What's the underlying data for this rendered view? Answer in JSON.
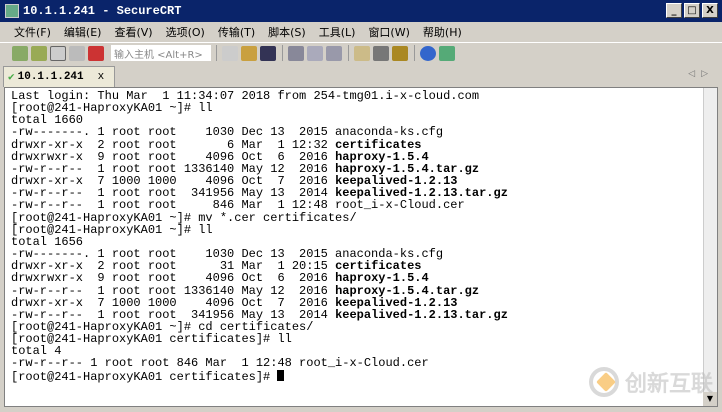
{
  "window": {
    "title": "10.1.1.241 - SecureCRT",
    "min": "_",
    "max": "□",
    "close": "X"
  },
  "menu": [
    "文件(F)",
    "编辑(E)",
    "查看(V)",
    "选项(O)",
    "传输(T)",
    "脚本(S)",
    "工具(L)",
    "窗口(W)",
    "帮助(H)"
  ],
  "toolbar": {
    "host_placeholder": "输入主机 <Alt+R>"
  },
  "tab": {
    "label": "10.1.1.241",
    "close": "x",
    "check": "✔",
    "arrows": "◁▷"
  },
  "terminal": {
    "lines": [
      [
        {
          "t": "Last login: Thu Mar  1 11:34:07 2018 from 254-tmg01.i-x-cloud.com"
        }
      ],
      [
        {
          "t": "[root@241-HaproxyKA01 ~]# ll"
        }
      ],
      [
        {
          "t": "total 1660"
        }
      ],
      [
        {
          "t": "-rw-------. 1 root root    1030 Dec 13  2015 anaconda-ks.cfg"
        }
      ],
      [
        {
          "t": "drwxr-xr-x  2 root root       6 Mar  1 12:32 "
        },
        {
          "t": "certificates",
          "b": true
        }
      ],
      [
        {
          "t": "drwxrwxr-x  9 root root    4096 Oct  6  2016 "
        },
        {
          "t": "haproxy-1.5.4",
          "b": true
        }
      ],
      [
        {
          "t": "-rw-r--r--  1 root root 1336140 May 12  2016 "
        },
        {
          "t": "haproxy-1.5.4.tar.gz",
          "b": true
        }
      ],
      [
        {
          "t": "drwxr-xr-x  7 1000 1000    4096 Oct  7  2016 "
        },
        {
          "t": "keepalived-1.2.13",
          "b": true
        }
      ],
      [
        {
          "t": "-rw-r--r--  1 root root  341956 May 13  2014 "
        },
        {
          "t": "keepalived-1.2.13.tar.gz",
          "b": true
        }
      ],
      [
        {
          "t": "-rw-r--r--  1 root root     846 Mar  1 12:48 root_i-x-Cloud.cer"
        }
      ],
      [
        {
          "t": "[root@241-HaproxyKA01 ~]# mv *.cer certificates/"
        }
      ],
      [
        {
          "t": "[root@241-HaproxyKA01 ~]# ll"
        }
      ],
      [
        {
          "t": "total 1656"
        }
      ],
      [
        {
          "t": "-rw-------. 1 root root    1030 Dec 13  2015 anaconda-ks.cfg"
        }
      ],
      [
        {
          "t": "drwxr-xr-x  2 root root      31 Mar  1 20:15 "
        },
        {
          "t": "certificates",
          "b": true
        }
      ],
      [
        {
          "t": "drwxrwxr-x  9 root root    4096 Oct  6  2016 "
        },
        {
          "t": "haproxy-1.5.4",
          "b": true
        }
      ],
      [
        {
          "t": "-rw-r--r--  1 root root 1336140 May 12  2016 "
        },
        {
          "t": "haproxy-1.5.4.tar.gz",
          "b": true
        }
      ],
      [
        {
          "t": "drwxr-xr-x  7 1000 1000    4096 Oct  7  2016 "
        },
        {
          "t": "keepalived-1.2.13",
          "b": true
        }
      ],
      [
        {
          "t": "-rw-r--r--  1 root root  341956 May 13  2014 "
        },
        {
          "t": "keepalived-1.2.13.tar.gz",
          "b": true
        }
      ],
      [
        {
          "t": "[root@241-HaproxyKA01 ~]# cd certificates/"
        }
      ],
      [
        {
          "t": "[root@241-HaproxyKA01 certificates]# ll"
        }
      ],
      [
        {
          "t": "total 4"
        }
      ],
      [
        {
          "t": "-rw-r--r-- 1 root root 846 Mar  1 12:48 root_i-x-Cloud.cer"
        }
      ],
      [
        {
          "t": "[root@241-HaproxyKA01 certificates]# "
        }
      ]
    ]
  },
  "watermark": {
    "text": "创新互联"
  },
  "colors": {
    "titlebar": "#0a246a",
    "terminal_bg": "#ffffff"
  }
}
